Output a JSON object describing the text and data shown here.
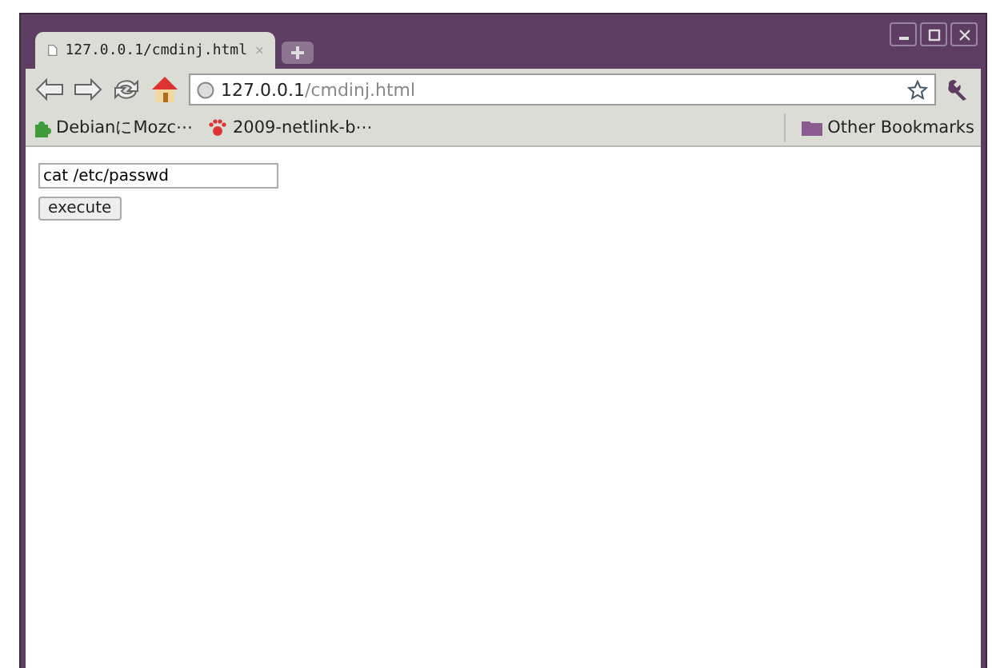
{
  "tabs": [
    {
      "title": "127.0.0.1/cmdinj.html",
      "selected": true
    }
  ],
  "address": {
    "host": "127.0.0.1",
    "path": "/cmdinj.html"
  },
  "bookmarks": [
    {
      "label": "DebianにMozc⋯",
      "kind": "debian"
    },
    {
      "label": "2009-netlink-b⋯",
      "kind": "paw"
    }
  ],
  "other_bookmarks": "Other Bookmarks",
  "page": {
    "command": "cat /etc/passwd",
    "button": "execute"
  }
}
